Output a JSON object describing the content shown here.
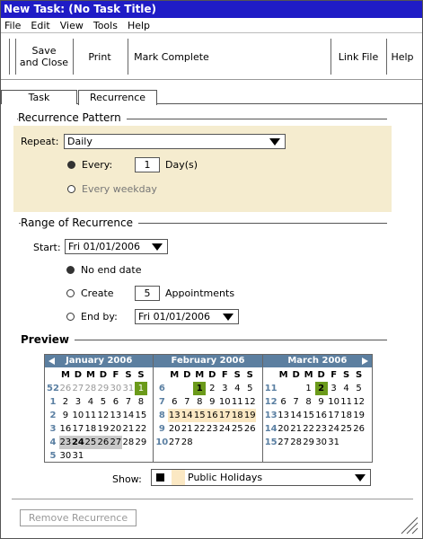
{
  "window": {
    "title": "New Task: (No Task Title)"
  },
  "menu": [
    "File",
    "Edit",
    "View",
    "Tools",
    "Help"
  ],
  "toolbar": {
    "save_close": "Save\nand Close",
    "print": "Print",
    "mark_complete": "Mark Complete",
    "link_file": "Link File",
    "help": "Help"
  },
  "tabs": {
    "task": "Task",
    "recurrence": "Recurrence"
  },
  "pattern": {
    "title": "Recurrence Pattern",
    "repeat_label": "Repeat:",
    "repeat_value": "Daily",
    "every_label": "Every:",
    "every_value": "1",
    "every_unit": "Day(s)",
    "weekday_label": "Every weekday"
  },
  "range": {
    "title": "Range of Recurrence",
    "start_label": "Start:",
    "start_value": "Fri 01/01/2006",
    "no_end_label": "No end date",
    "create_label": "Create",
    "create_value": "5",
    "create_unit": "Appointments",
    "end_by_label": "End by:",
    "end_by_value": "Fri 01/01/2006"
  },
  "preview": {
    "title": "Preview",
    "weekday_headers": [
      "M",
      "D",
      "M",
      "D",
      "F",
      "S",
      "S"
    ],
    "months": [
      {
        "name": "January 2006",
        "weeks": [
          {
            "wk": "52",
            "days": [
              "26",
              "27",
              "28",
              "29",
              "30",
              "31",
              "1"
            ]
          },
          {
            "wk": "1",
            "days": [
              "2",
              "3",
              "4",
              "5",
              "6",
              "7",
              "8"
            ]
          },
          {
            "wk": "2",
            "days": [
              "9",
              "10",
              "11",
              "12",
              "13",
              "14",
              "15"
            ]
          },
          {
            "wk": "3",
            "days": [
              "16",
              "17",
              "18",
              "19",
              "20",
              "21",
              "22"
            ]
          },
          {
            "wk": "4",
            "days": [
              "23",
              "24",
              "25",
              "26",
              "27",
              "28",
              "29"
            ]
          },
          {
            "wk": "5",
            "days": [
              "30",
              "31",
              "",
              "",
              "",
              "",
              ""
            ]
          }
        ]
      },
      {
        "name": "February 2006",
        "weeks": [
          {
            "wk": "6",
            "days": [
              "",
              "",
              "1",
              "2",
              "3",
              "4",
              "5"
            ]
          },
          {
            "wk": "7",
            "days": [
              "6",
              "7",
              "8",
              "9",
              "10",
              "11",
              "12"
            ]
          },
          {
            "wk": "8",
            "days": [
              "13",
              "14",
              "15",
              "16",
              "17",
              "18",
              "19"
            ]
          },
          {
            "wk": "9",
            "days": [
              "20",
              "21",
              "22",
              "23",
              "24",
              "25",
              "26"
            ]
          },
          {
            "wk": "10",
            "days": [
              "27",
              "28",
              "",
              "",
              "",
              "",
              ""
            ]
          },
          {
            "wk": "",
            "days": [
              "",
              "",
              "",
              "",
              "",
              "",
              ""
            ]
          }
        ]
      },
      {
        "name": "March 2006",
        "weeks": [
          {
            "wk": "11",
            "days": [
              "",
              "",
              "1",
              "2",
              "3",
              "4",
              "5"
            ]
          },
          {
            "wk": "12",
            "days": [
              "6",
              "7",
              "8",
              "9",
              "10",
              "11",
              "12"
            ]
          },
          {
            "wk": "13",
            "days": [
              "13",
              "14",
              "15",
              "16",
              "17",
              "18",
              "19"
            ]
          },
          {
            "wk": "14",
            "days": [
              "20",
              "21",
              "22",
              "23",
              "24",
              "25",
              "26"
            ]
          },
          {
            "wk": "15",
            "days": [
              "27",
              "28",
              "29",
              "30",
              "31",
              "",
              ""
            ]
          },
          {
            "wk": "",
            "days": [
              "",
              "",
              "",
              "",
              "",
              "",
              ""
            ]
          }
        ]
      }
    ],
    "show_label": "Show:",
    "show_value": "Public Holidays"
  },
  "footer": {
    "remove_label": "Remove Recurrence"
  },
  "colors": {
    "title_bar": "#1f1cc6",
    "month_header": "#5c7fa0",
    "accent_green": "#6b9a1a",
    "pattern_bg": "#f5eccf",
    "holiday_bg": "#fbe8c3"
  }
}
